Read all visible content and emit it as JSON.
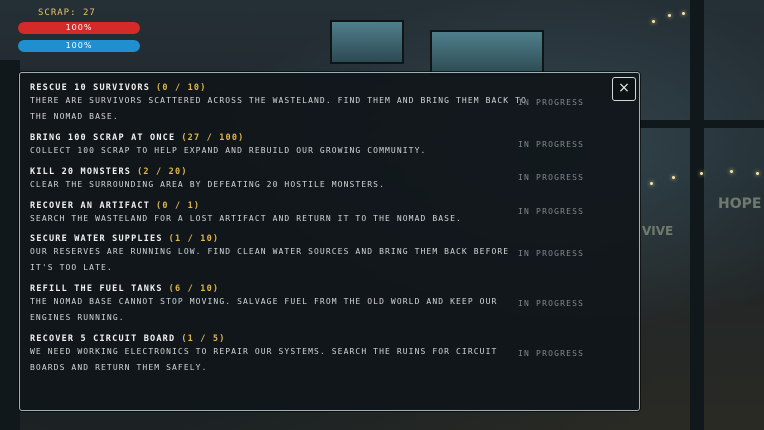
{
  "hud": {
    "scrap_label": "SCRAP:",
    "scrap_value": "27",
    "health_text": "100%",
    "health_fraction": 1.0,
    "energy_text": "100%",
    "energy_fraction": 1.0
  },
  "background": {
    "sign_hope": "HOPE",
    "sign_vive": "VIVE"
  },
  "panel": {
    "close_icon": "×",
    "quests": [
      {
        "title": "RESCUE 10 SURVIVORS",
        "progress": "(0 / 10)",
        "desc": "THERE ARE SURVIVORS SCATTERED ACROSS THE WASTELAND. FIND THEM AND BRING THEM BACK TO THE NOMAD BASE.",
        "status": "IN PROGRESS"
      },
      {
        "title": "BRING 100 SCRAP AT ONCE",
        "progress": "(27 / 100)",
        "desc": "COLLECT 100 SCRAP TO HELP EXPAND AND REBUILD OUR GROWING COMMUNITY.",
        "status": "IN PROGRESS"
      },
      {
        "title": "KILL 20 MONSTERS",
        "progress": "(2 / 20)",
        "desc": "CLEAR THE SURROUNDING AREA BY DEFEATING 20 HOSTILE MONSTERS.",
        "status": "IN PROGRESS"
      },
      {
        "title": "RECOVER AN ARTIFACT",
        "progress": "(0 / 1)",
        "desc": "SEARCH THE WASTELAND FOR A LOST ARTIFACT AND RETURN IT TO THE NOMAD BASE.",
        "status": "IN PROGRESS"
      },
      {
        "title": "SECURE WATER SUPPLIES",
        "progress": "(1 / 10)",
        "desc": "OUR RESERVES ARE RUNNING LOW. FIND CLEAN WATER SOURCES AND BRING THEM BACK BEFORE IT'S TOO LATE.",
        "status": "IN PROGRESS"
      },
      {
        "title": "REFILL THE FUEL TANKS",
        "progress": "(6 / 10)",
        "desc": "THE NOMAD BASE CANNOT STOP MOVING. SALVAGE FUEL FROM THE OLD WORLD AND KEEP OUR ENGINES RUNNING.",
        "status": "IN PROGRESS"
      },
      {
        "title": "RECOVER 5 CIRCUIT BOARD",
        "progress": "(1 / 5)",
        "desc": "WE NEED WORKING ELECTRONICS TO REPAIR OUR SYSTEMS. SEARCH THE RUINS FOR CIRCUIT BOARDS AND RETURN THEM SAFELY.",
        "status": "IN PROGRESS"
      }
    ]
  }
}
